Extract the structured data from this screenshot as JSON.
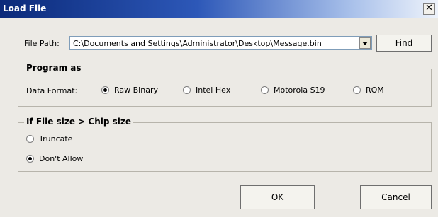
{
  "dialog": {
    "title": "Load File",
    "close_glyph": "✕"
  },
  "file_path": {
    "label": "File Path:",
    "value": "C:\\Documents and Settings\\Administrator\\Desktop\\Message.bin",
    "find_label": "Find"
  },
  "program_as": {
    "legend": "Program as",
    "label": "Data Format:",
    "options": [
      {
        "label": "Raw Binary",
        "selected": true
      },
      {
        "label": "Intel Hex",
        "selected": false
      },
      {
        "label": "Motorola S19",
        "selected": false
      },
      {
        "label": "ROM",
        "selected": false
      }
    ]
  },
  "size_policy": {
    "legend": "If File size > Chip size",
    "options": [
      {
        "label": "Truncate",
        "selected": false
      },
      {
        "label": "Don't Allow",
        "selected": true
      }
    ]
  },
  "footer": {
    "ok_label": "OK",
    "cancel_label": "Cancel"
  }
}
